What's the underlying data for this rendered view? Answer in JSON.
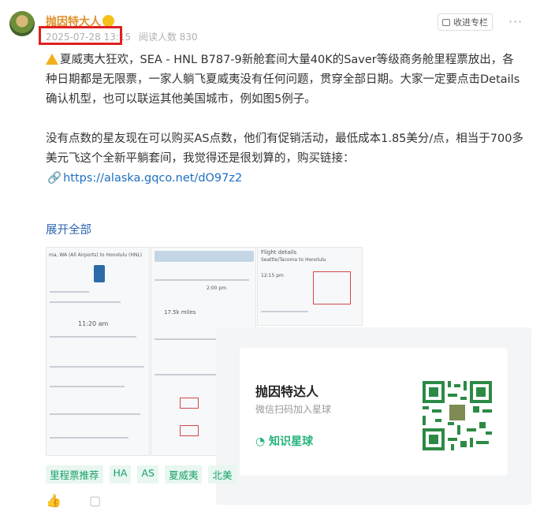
{
  "post": {
    "author": "抛因特大人",
    "timestamp": "2025-07-28 13:15",
    "read_count": "阅读人数 830",
    "collect_label": "收进专栏",
    "paragraph1": "夏威夷大狂欢，SEA - HNL B787-9新舱套间大量40K的Saver等级商务舱里程票放出，各种日期都是无限票，一家人躺飞夏威夷没有任何问题，贯穿全部日期。大家一定要点击Details确认机型，也可以联运其他美国城市，例如图5例子。",
    "paragraph2": "没有点数的星友现在可以购买AS点数，他们有促销活动，最低成本1.85美分/点，相当于700多美元飞这个全新平躺套间，我觉得还是很划算的，购买链接：",
    "link_text": "https://alaska.gqco.net/dO97z2",
    "expand_label": "展开全部"
  },
  "images": {
    "thumb1_header": "ma, WA (All Airports) to Honolulu (HNL)",
    "thumb1_time": "11:20 am",
    "thumb1_miles": "17.5k miles",
    "thumb2_time": "2:00 pm",
    "thumb3_header": "Flight details",
    "thumb3_sub": "Seattle/Tacoma to Honolulu",
    "thumb3_time": "12:15 pm"
  },
  "qr": {
    "title": "抛因特达人",
    "subtitle": "微信扫码加入星球",
    "brand": "知识星球"
  },
  "tags": [
    "里程票推荐",
    "HA",
    "AS",
    "夏威夷",
    "北美"
  ],
  "colors": {
    "accent": "#1aa16a",
    "link": "#1e6fbf",
    "author": "#e0902a",
    "highlight": "#e02020"
  }
}
